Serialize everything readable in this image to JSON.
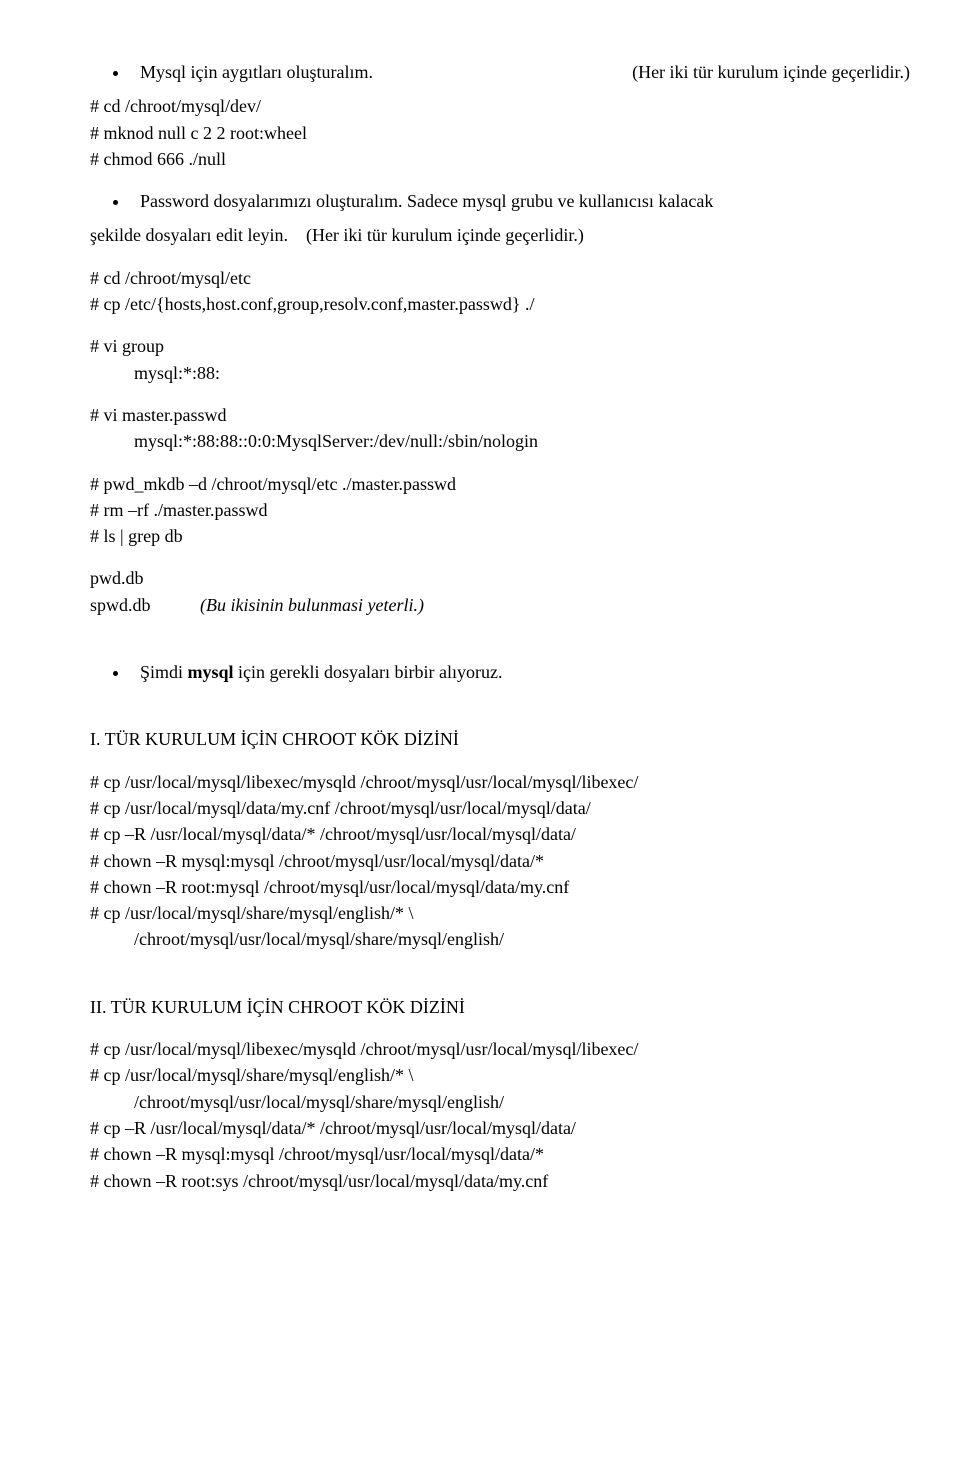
{
  "s1": {
    "bullet": "Mysql için aygıtları oluşturalım.",
    "note": "(Her iki tür kurulum içinde geçerlidir.)",
    "l1": "#  cd  /chroot/mysql/dev/",
    "l2": "#  mknod  null  c  2  2  root:wheel",
    "l3": "#  chmod  666 ./null"
  },
  "s2": {
    "bullet_a": "Password dosyalarımızı oluşturalım.",
    "bullet_b1": "Sadece mysql grubu ve kullanıcısı kalacak",
    "bullet_b2": "şekilde dosyaları edit leyin.",
    "bullet_b3": "(Her iki tür kurulum içinde geçerlidir.)"
  },
  "s3": {
    "l1": "#  cd  /chroot/mysql/etc",
    "l2": "#  cp /etc/{hosts,host.conf,group,resolv.conf,master.passwd}  ./"
  },
  "s4": {
    "l1": "#  vi group",
    "l2": "mysql:*:88:"
  },
  "s5": {
    "l1": "#  vi master.passwd",
    "l2": "mysql:*:88:88::0:0:MysqlServer:/dev/null:/sbin/nologin"
  },
  "s6": {
    "l1": "#  pwd_mkdb  –d  /chroot/mysql/etc   ./master.passwd",
    "l2": "#  rm  –rf  ./master.passwd",
    "l3": "#  ls  | grep db"
  },
  "s7": {
    "l1": "pwd.db",
    "l2a": "spwd.db",
    "l2b": "(Bu ikisinin bulunmasi yeterli.)"
  },
  "s8": {
    "bullet_a": "Şimdi ",
    "bullet_b": "mysql",
    "bullet_c": " için gerekli dosyaları birbir alıyoruz."
  },
  "s9": {
    "title": "I. TÜR KURULUM İÇİN CHROOT KÖK DİZİNİ",
    "l1": "#  cp /usr/local/mysql/libexec/mysqld    /chroot/mysql/usr/local/mysql/libexec/",
    "l2": "#  cp /usr/local/mysql/data/my.cnf    /chroot/mysql/usr/local/mysql/data/",
    "l3": "#  cp –R /usr/local/mysql/data/*   /chroot/mysql/usr/local/mysql/data/",
    "l4": "#  chown –R mysql:mysql   /chroot/mysql/usr/local/mysql/data/*",
    "l5": "#  chown –R root:mysql      /chroot/mysql/usr/local/mysql/data/my.cnf",
    "l6": "#  cp /usr/local/mysql/share/mysql/english/* \\",
    "l7": "/chroot/mysql/usr/local/mysql/share/mysql/english/"
  },
  "s10": {
    "title": "II. TÜR KURULUM İÇİN CHROOT KÖK DİZİNİ",
    "l1": "#  cp /usr/local/mysql/libexec/mysqld    /chroot/mysql/usr/local/mysql/libexec/",
    "l2": "#  cp /usr/local/mysql/share/mysql/english/* \\",
    "l3": "/chroot/mysql/usr/local/mysql/share/mysql/english/",
    "l4": "#  cp –R /usr/local/mysql/data/*   /chroot/mysql/usr/local/mysql/data/",
    "l5": "#  chown –R mysql:mysql   /chroot/mysql/usr/local/mysql/data/*",
    "l6": "#  chown –R root:sys      /chroot/mysql/usr/local/mysql/data/my.cnf"
  }
}
